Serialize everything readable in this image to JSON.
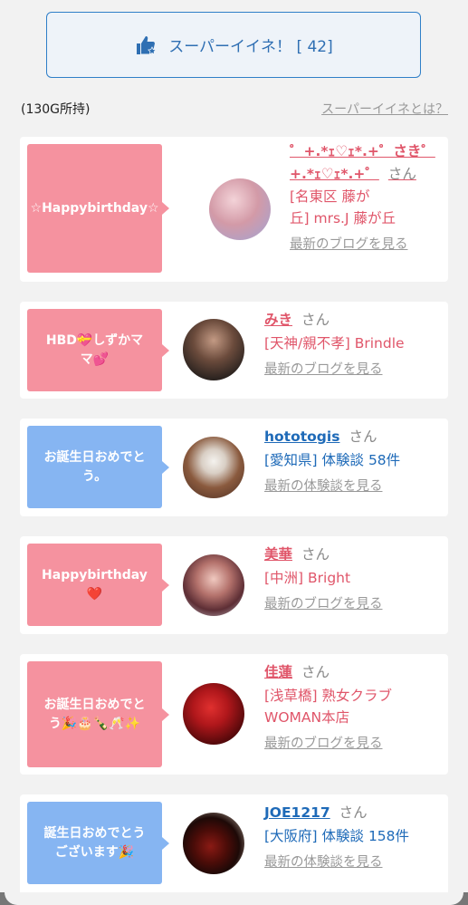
{
  "top_button": {
    "label": "スーパーイイネ！ [ 42]",
    "icon": "thumbs-up-star-icon",
    "color": "#2f7fc8"
  },
  "holding": "(130G所持)",
  "about_link": "スーパーイイネとは？",
  "cards": [
    {
      "message": "☆Happybirthday☆",
      "color": "pink",
      "name_line1": "゜+.*ｪ♡ｪ*.+゜さき゜",
      "name_line2": "+.*ｪ♡ｪ*.+゜",
      "san": "さん",
      "detail_line1": "[名東区 藤が",
      "detail_line2": "丘] mrs.J 藤が丘",
      "link": "最新のブログを見る"
    },
    {
      "message_line1": "HBD💝しずかマ",
      "message_line2": "マ💕",
      "color": "pink",
      "name": "みき",
      "san": "さん",
      "detail": "[天神/親不孝] Brindle",
      "link": "最新のブログを見る"
    },
    {
      "message_line1": "お誕生日おめでと",
      "message_line2": "う。",
      "color": "blue",
      "name": "hototogis",
      "san": "さん",
      "detail": "[愛知県] 体験談 58件",
      "link": "最新の体験談を見る"
    },
    {
      "message_line1": "Happybirthday",
      "message_line2": "❤️",
      "color": "pink",
      "name": "美華",
      "san": "さん",
      "detail": "[中洲] Bright",
      "link": "最新のブログを見る"
    },
    {
      "message_line1": "お誕生日おめでと",
      "message_line2": "う🎉🎂🍾🥂✨",
      "color": "pink",
      "name": "佳蓮",
      "san": "さん",
      "detail_line1": "[浅草橋] 熟女クラブ",
      "detail_line2": "WOMAN本店",
      "link": "最新のブログを見る"
    },
    {
      "message_line1": "誕生日おめでとう",
      "message_line2": "ございます🎉",
      "color": "blue",
      "name": "JOE1217",
      "san": "さん",
      "detail": "[大阪府] 体験談 158件",
      "link": "最新の体験談を見る"
    }
  ]
}
